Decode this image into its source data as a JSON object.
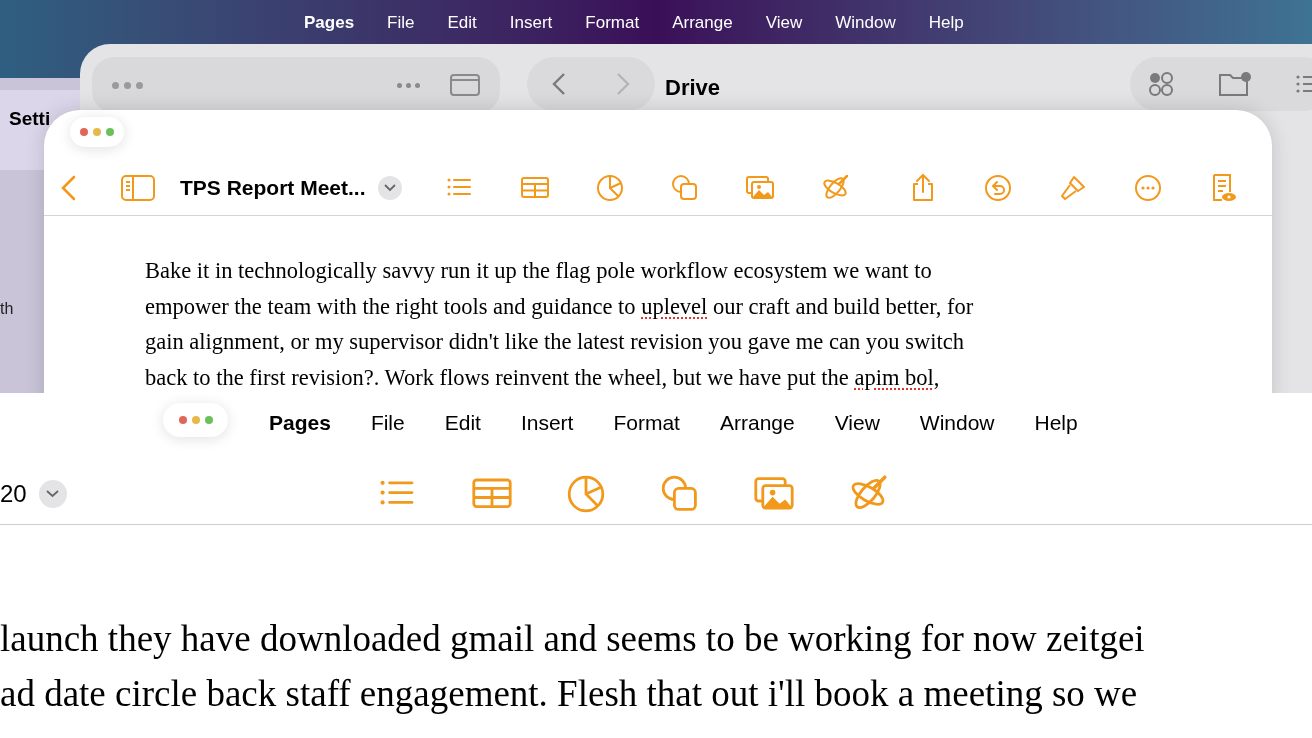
{
  "top_screen": {
    "menu_bar": [
      "Pages",
      "File",
      "Edit",
      "Insert",
      "Format",
      "Arrange",
      "View",
      "Window",
      "Help"
    ],
    "settings_window": {
      "title": "Setti",
      "row_text": "th"
    },
    "files_window": {
      "title": "Drive"
    },
    "pages_window": {
      "document_title": "TPS Report Meet...",
      "paragraph_lines": [
        [
          {
            "text": "Bake it in technologically savvy run it up the flag pole workflow ecosystem we want to",
            "misspelled": false
          }
        ],
        [
          {
            "text": "empower the team with the right tools and guidance to ",
            "misspelled": false
          },
          {
            "text": "uplevel",
            "misspelled": true
          },
          {
            "text": " our craft and build better, for",
            "misspelled": false
          }
        ],
        [
          {
            "text": "gain alignment, or my supervisor didn't like the latest revision you gave me can you switch",
            "misspelled": false
          }
        ],
        [
          {
            "text": "back to the first revision?. Work flows reinvent the wheel, but we have put the ",
            "misspelled": false
          },
          {
            "text": "apim bol",
            "misspelled": true
          },
          {
            "text": ",",
            "misspelled": false
          }
        ]
      ]
    }
  },
  "bottom_screen": {
    "menu_bar": [
      "Pages",
      "File",
      "Edit",
      "Insert",
      "Format",
      "Arrange",
      "View",
      "Window",
      "Help"
    ],
    "zoom": "20",
    "body_lines": [
      "launch they have downloaded gmail and seems to be working for now zeitgei",
      "ad date circle back staff engagement. Flesh that out i'll book a meeting so we"
    ]
  }
}
